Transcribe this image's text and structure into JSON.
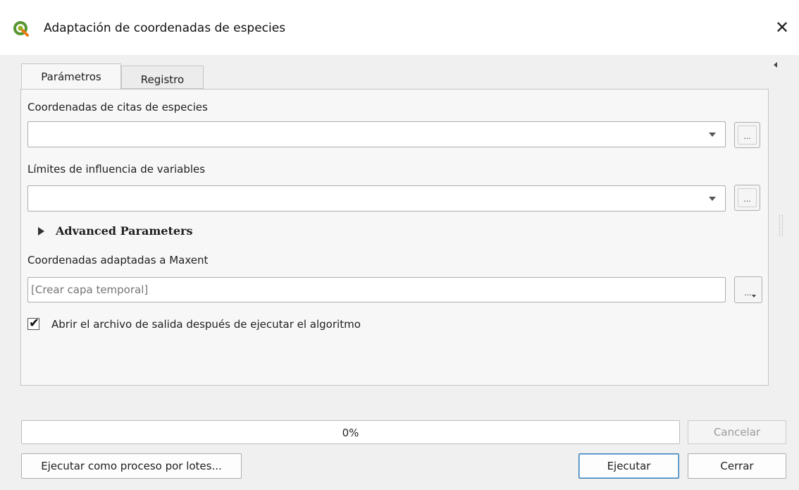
{
  "window": {
    "title": "Adaptación de coordenadas de especies",
    "icon": "qgis-icon",
    "close_glyph": "✕"
  },
  "tabs": [
    {
      "label": "Parámetros",
      "active": true
    },
    {
      "label": "Registro",
      "active": false
    }
  ],
  "params": {
    "species_coords_label": "Coordenadas de citas de especies",
    "species_coords_value": "",
    "limits_label": "Límites de influencia de variables",
    "limits_value": "",
    "browse_glyph": "...",
    "advanced_label": "Advanced Parameters",
    "output_label": "Coordenadas adaptadas a Maxent",
    "output_placeholder": "[Crear capa temporal]",
    "output_value": "",
    "open_output_label": "Abrir el archivo de salida después de ejecutar el algoritmo",
    "open_output_checked": true,
    "check_glyph": "✔"
  },
  "progress": {
    "value_percent": 0,
    "text": "0%",
    "fill_color": "#06b025"
  },
  "buttons": {
    "cancel": "Cancelar",
    "batch": "Ejecutar como proceso por lotes...",
    "run": "Ejecutar",
    "close": "Cerrar"
  }
}
